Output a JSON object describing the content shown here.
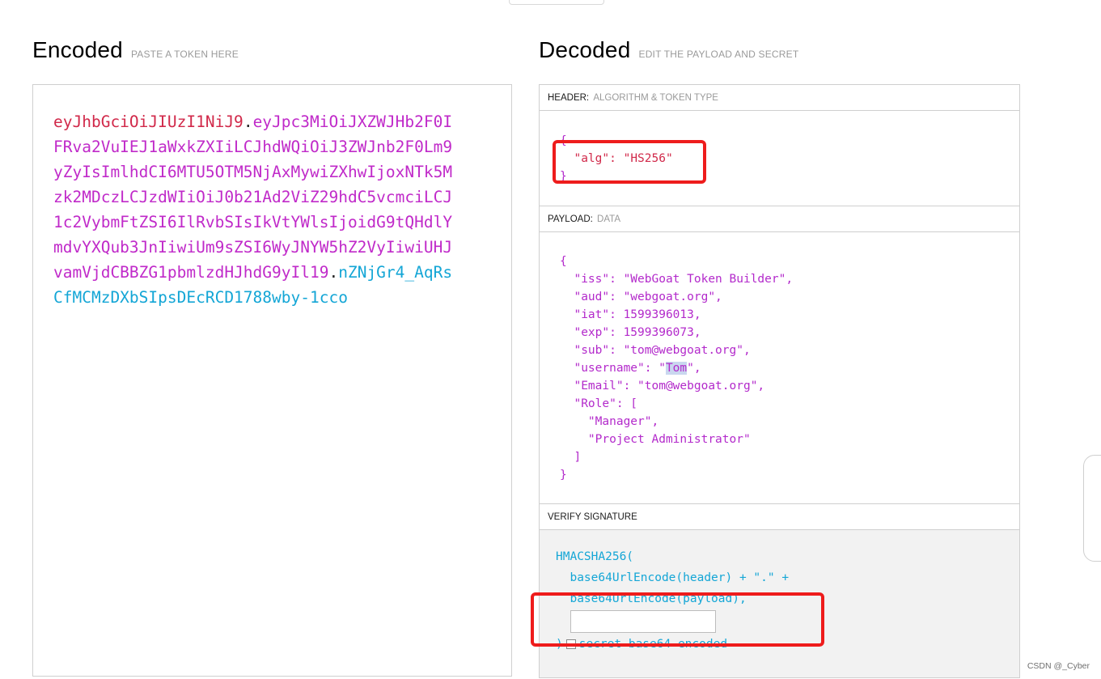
{
  "encoded": {
    "title": "Encoded",
    "subtitle": "PASTE A TOKEN HERE",
    "token_header": "eyJhbGciOiJIUzI1NiJ9",
    "token_payload": "eyJpc3MiOiJXZWJHb2F0IFRva2VuIEJ1aWxkZXIiLCJhdWQiOiJ3ZWJnb2F0Lm9yZyIsImlhdCI6MTU5OTM5NjAxMywiZXhwIjoxNTk5Mzk2MDczLCJzdWIiOiJ0b21Ad2ViZ29hdC5vcmciLCJ1c2VybmFtZSI6IlRvbSIsIkVtYWlsIjoidG9tQHdlYmdvYXQub3JnIiwiUm9sZSI6WyJNYW5hZ2VyIiwiUHJvamVjdCBBZG1pbmlzdHJhdG9yIl19",
    "token_signature": "nZNjGr4_AqRsCfMCMzDXbSIpsDEcRCD1788wby-1cco",
    "dot": "."
  },
  "decoded": {
    "title": "Decoded",
    "subtitle": "EDIT THE PAYLOAD AND SECRET",
    "header_label": "HEADER:",
    "header_hint": "ALGORITHM & TOKEN TYPE",
    "header_json": {
      "open": "{",
      "alg_key": "\"alg\"",
      "alg_value": "\"HS256\"",
      "close": "}"
    },
    "payload_label": "PAYLOAD:",
    "payload_hint": "DATA",
    "payload_lines": {
      "open": "{",
      "iss": "  \"iss\": \"WebGoat Token Builder\",",
      "aud": "  \"aud\": \"webgoat.org\",",
      "iat": "  \"iat\": 1599396013,",
      "exp": "  \"exp\": 1599396073,",
      "sub": "  \"sub\": \"tom@webgoat.org\",",
      "username_prefix": "  \"username\": \"",
      "username_value": "Tom",
      "username_suffix": "\",",
      "email": "  \"Email\": \"tom@webgoat.org\",",
      "role_open": "  \"Role\": [",
      "role_1": "    \"Manager\",",
      "role_2": "    \"Project Administrator\"",
      "role_close": "  ]",
      "close": "}"
    },
    "verify_label": "VERIFY SIGNATURE",
    "verify": {
      "fn": "HMACSHA256(",
      "line1": "  base64UrlEncode(header) + \".\" +",
      "line2": "  base64UrlEncode(payload),",
      "secret_value": "",
      "close": ")",
      "b64_label": "secret base64 encoded"
    }
  },
  "colors": {
    "header_red": "#d1294a",
    "payload_purple": "#c02ac9",
    "signature_blue": "#14a6d6",
    "highlight_red": "#ee1c1c"
  },
  "watermark": "CSDN @_Cyber"
}
